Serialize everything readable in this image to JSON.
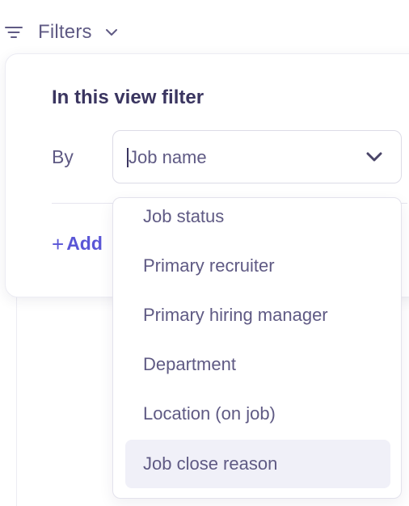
{
  "header": {
    "filters_label": "Filters"
  },
  "panel": {
    "title": "In this view filter",
    "by_label": "By",
    "add_label": "Add"
  },
  "select": {
    "value": "Job name"
  },
  "menu": {
    "items": [
      {
        "label": "Job status"
      },
      {
        "label": "Primary recruiter"
      },
      {
        "label": "Primary hiring manager"
      },
      {
        "label": "Department"
      },
      {
        "label": "Location (on job)"
      },
      {
        "label": "Job close reason"
      }
    ],
    "highlighted_item": "Job close reason"
  },
  "colors": {
    "text_muted": "#5f5a84",
    "title": "#3a3560",
    "accent": "#5a56d6",
    "highlight_bg": "#f0f0f8"
  }
}
